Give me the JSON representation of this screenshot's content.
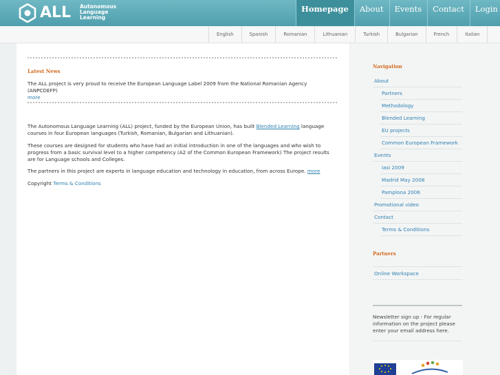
{
  "header": {
    "logo_word": "ALL",
    "tagline": [
      "Autonomous",
      "Language",
      "Learning"
    ],
    "nav": [
      "Homepage",
      "About",
      "Events",
      "Contact",
      "Login"
    ]
  },
  "languages": [
    "English",
    "Spanish",
    "Romanian",
    "Lithuanian",
    "Turkish",
    "Bulgarian",
    "French",
    "Italian"
  ],
  "main": {
    "news_title": "Latest News",
    "news_text": "The ALL project is very proud to receive the European Language Label 2009 from the National Romanian Agency (ANPCDEFP)",
    "news_more": "more",
    "p1_before": "The Autonomous Language Learning (ALL) project, funded by the European Union, has built",
    "p1_link": "Blended Learning",
    "p1_after": "language courses in four European languages (Turkish, Romanian, Bulgarian and Lithuanian).",
    "p2": "These courses are designed for students who have had an initial introduction in one of the languages and who wish to progress from a basic survival level to a higher competency (A2 of the Common European Framework) The project results are for Language schools and Colleges.",
    "p3": "The partners in this project are experts in language education and technology in education, from across Europe.",
    "p3_more": "more",
    "copyright": "Copyright",
    "terms": "Terms & Conditions"
  },
  "sidebar": {
    "nav_title": "Navigation",
    "nav_items": [
      "About",
      "Partners",
      "Methodology",
      "Blended Learning",
      "EU projects",
      "Common European Framework",
      "Events",
      "Iasi 2009",
      "Madrid May 2008",
      "Pamplona 2006",
      "Promotional video",
      "Contact",
      "Terms & Conditions"
    ],
    "partners_title": "Partners",
    "partners_item": "Online Workspace",
    "newsletter": "Newsletter sign up - For regular information on the project please enter your email address here."
  },
  "colors": {
    "header": "#5aa8b5",
    "accent": "#d26a1d",
    "link": "#2e7fb0"
  }
}
